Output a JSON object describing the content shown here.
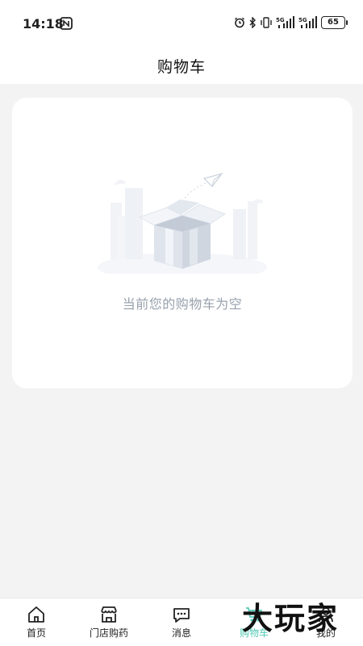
{
  "status_bar": {
    "time": "14:18",
    "battery_level": "65",
    "icons": [
      "nfc-icon",
      "alarm-icon",
      "bluetooth-icon",
      "vibrate-icon",
      "signal-5g-icon",
      "signal-5g-icon"
    ]
  },
  "header": {
    "title": "购物车"
  },
  "empty_state": {
    "message": "当前您的购物车为空",
    "illustration": "empty-box-illustration"
  },
  "bottom_nav": {
    "items": [
      {
        "label": "首页",
        "icon": "home-icon",
        "active": false
      },
      {
        "label": "门店购药",
        "icon": "store-icon",
        "active": false
      },
      {
        "label": "消息",
        "icon": "message-icon",
        "active": false
      },
      {
        "label": "购物车",
        "icon": "cart-icon",
        "active": true
      },
      {
        "label": "我的",
        "icon": "user-icon",
        "active": false
      }
    ]
  },
  "watermark": {
    "text": "大玩家"
  },
  "colors": {
    "accent": "#52c9b5",
    "background": "#f3f3f3",
    "empty_text": "#98a1ad"
  }
}
